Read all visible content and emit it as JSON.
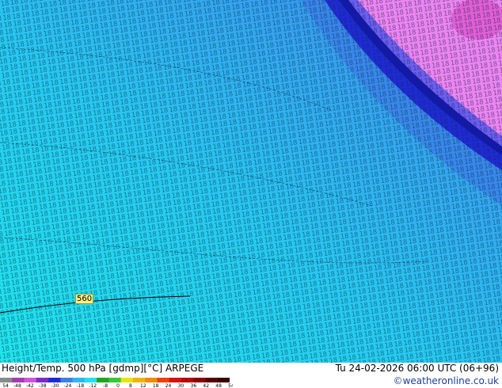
{
  "map": {
    "contour_value_label": "560",
    "field_values_shown": [
      "13",
      "14",
      "15",
      "16",
      "17",
      "18",
      "19",
      "20",
      "21",
      "22",
      "23",
      "24",
      "25"
    ],
    "colors": {
      "cyan": "#22e0f0",
      "light_blue": "#2fb6ef",
      "blue": "#3a7fe8",
      "dark_blue": "#1f2ad6",
      "navy": "#1418b0",
      "purple": "#6d5df0",
      "pink": "#ee84f2",
      "magenta": "#e35ed6"
    }
  },
  "footer": {
    "title": "Height/Temp. 500 hPa [gdmp][°C] ARPEGE",
    "datetime": "Tu 24-02-2026 06:00 UTC (06+96)",
    "credit": "©weatheronline.co.uk",
    "legend_labels": [
      "-54",
      "-48",
      "-42",
      "-38",
      "-30",
      "-24",
      "-18",
      "-12",
      "-8",
      "0",
      "8",
      "12",
      "18",
      "24",
      "30",
      "36",
      "42",
      "48",
      "54"
    ],
    "legend_colors": [
      "#8a8a8a",
      "#a53bb0",
      "#d154d8",
      "#7a2cc8",
      "#1f2ad6",
      "#3a7fe8",
      "#2fb6ef",
      "#22e0f0",
      "#1fa51f",
      "#36c836",
      "#e6e600",
      "#f0b400",
      "#f08a00",
      "#f04000",
      "#d81010",
      "#b40a0a",
      "#8c0000",
      "#5a0000",
      "#3a0000"
    ]
  }
}
